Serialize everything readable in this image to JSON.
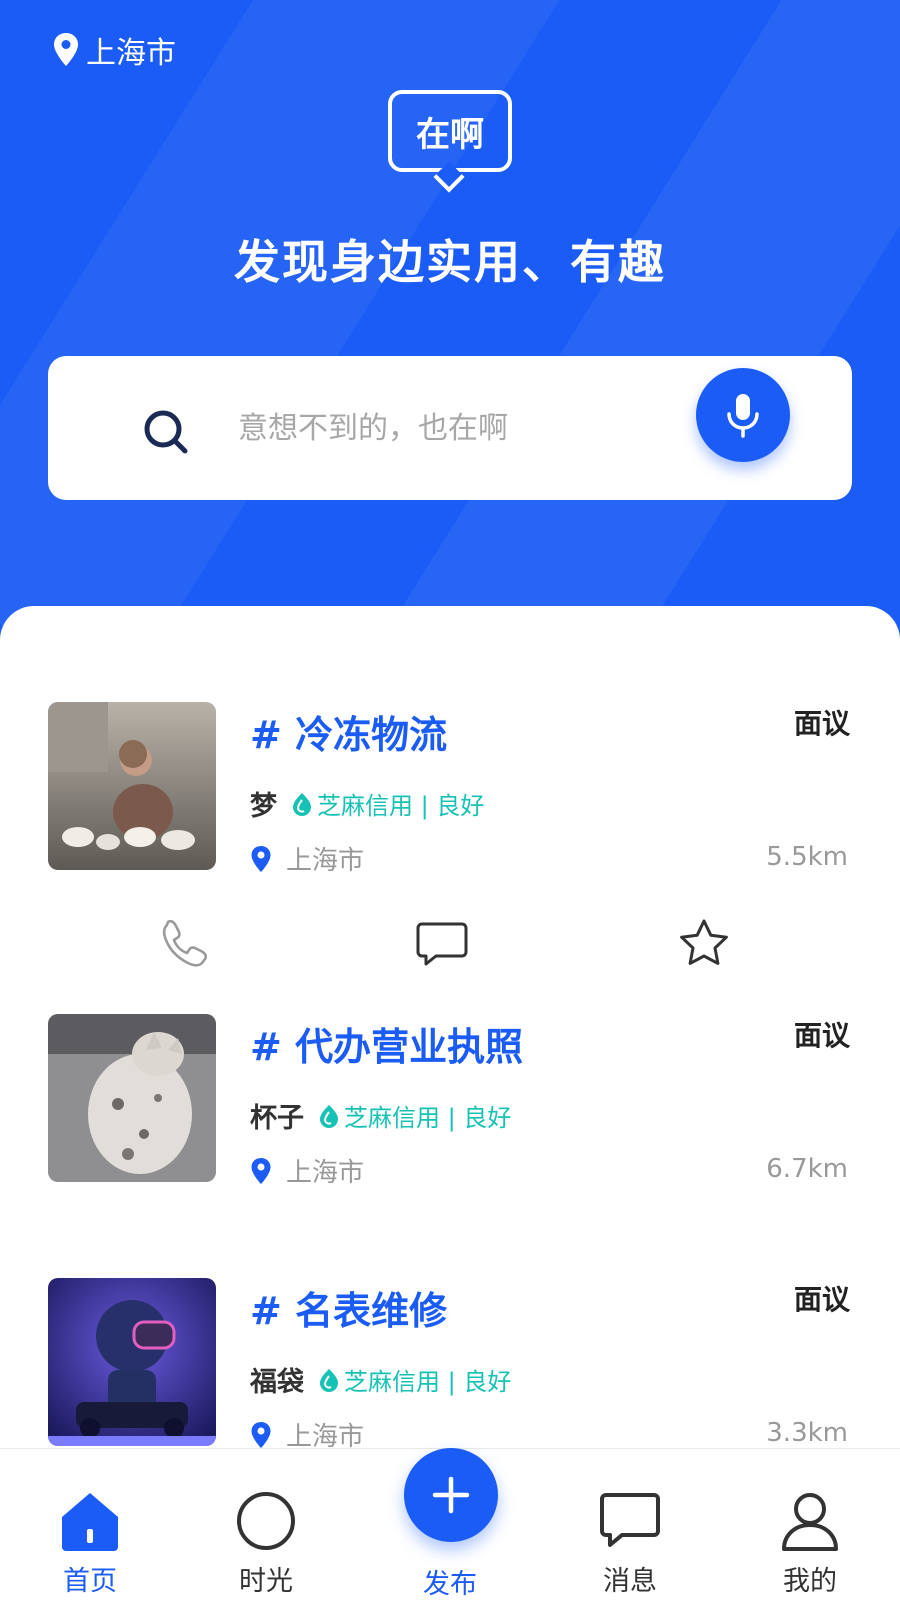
{
  "header": {
    "location": "上海市",
    "logo_text": "在啊",
    "slogan": "发现身边实用、有趣"
  },
  "search": {
    "placeholder": "意想不到的，也在啊",
    "icon": "search-icon",
    "voice_icon": "microphone-icon"
  },
  "listings": [
    {
      "title": "# 冷冻物流",
      "price": "面议",
      "user": "梦",
      "credit": "芝麻信用 | 良好",
      "location": "上海市",
      "distance": "5.5km",
      "image": "girl-with-rabbits-photo"
    },
    {
      "title": "# 代办营业执照",
      "price": "面议",
      "user": "杯子",
      "credit": "芝麻信用 | 良好",
      "location": "上海市",
      "distance": "6.7km",
      "image": "sleeping-cat-photo"
    },
    {
      "title": "# 名表维修",
      "price": "面议",
      "user": "福袋",
      "credit": "芝麻信用 | 良好",
      "location": "上海市",
      "distance": "3.3km",
      "image": "astronaut-car-art"
    }
  ],
  "actions": [
    "phone-icon",
    "chat-icon",
    "star-icon"
  ],
  "tabbar": {
    "items": [
      {
        "label": "首页",
        "icon": "home-icon",
        "active": true
      },
      {
        "label": "时光",
        "icon": "circle-icon",
        "active": false
      },
      {
        "label": "发布",
        "icon": "plus-icon",
        "active": false
      },
      {
        "label": "消息",
        "icon": "message-icon",
        "active": false
      },
      {
        "label": "我的",
        "icon": "user-icon",
        "active": false
      }
    ]
  },
  "colors": {
    "primary": "#1a5cf5",
    "credit": "#17c2b5",
    "muted": "#999999"
  }
}
